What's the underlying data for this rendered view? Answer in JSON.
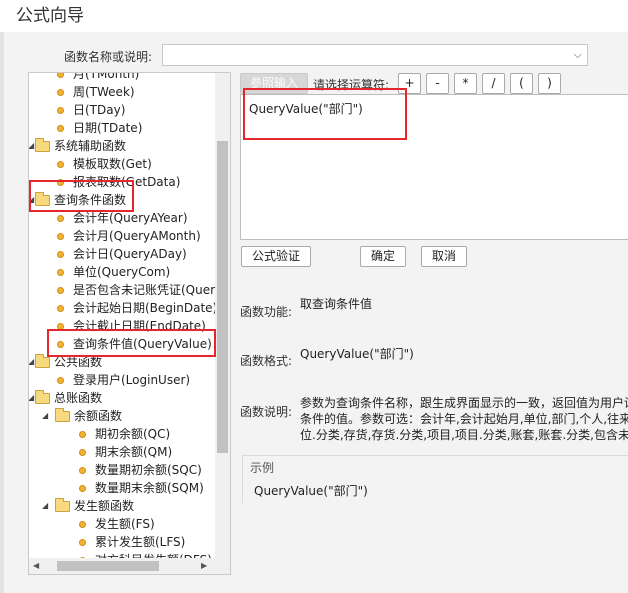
{
  "window": {
    "title": "公式向导"
  },
  "search": {
    "label": "函数名称或说明:",
    "value": ""
  },
  "tree": [
    {
      "label": "月(TMonth)",
      "type": "leaf",
      "level": 2
    },
    {
      "label": "周(TWeek)",
      "type": "leaf",
      "level": 2
    },
    {
      "label": "日(TDay)",
      "type": "leaf",
      "level": 2
    },
    {
      "label": "日期(TDate)",
      "type": "leaf",
      "level": 2
    },
    {
      "label": "系统辅助函数",
      "type": "folder",
      "level": 1,
      "expanded": true
    },
    {
      "label": "模板取数(Get)",
      "type": "leaf",
      "level": 2
    },
    {
      "label": "报表取数(GetData)",
      "type": "leaf",
      "level": 2
    },
    {
      "label": "查询条件函数",
      "type": "folder",
      "level": 1,
      "expanded": true
    },
    {
      "label": "会计年(QueryAYear)",
      "type": "leaf",
      "level": 2
    },
    {
      "label": "会计月(QueryAMonth)",
      "type": "leaf",
      "level": 2
    },
    {
      "label": "会计日(QueryADay)",
      "type": "leaf",
      "level": 2
    },
    {
      "label": "单位(QueryCom)",
      "type": "leaf",
      "level": 2
    },
    {
      "label": "是否包含未记账凭证(QueryIncludeUnpost)",
      "type": "leaf",
      "level": 2
    },
    {
      "label": "会计起始日期(BeginDate)",
      "type": "leaf",
      "level": 2
    },
    {
      "label": "会计截止日期(EndDate)",
      "type": "leaf",
      "level": 2
    },
    {
      "label": "查询条件值(QueryValue)",
      "type": "leaf",
      "level": 2,
      "selected": true
    },
    {
      "label": "公共函数",
      "type": "folder",
      "level": 1,
      "expanded": true
    },
    {
      "label": "登录用户(LoginUser)",
      "type": "leaf",
      "level": 2
    },
    {
      "label": "总账函数",
      "type": "folder",
      "level": 1,
      "expanded": true
    },
    {
      "label": "余额函数",
      "type": "folder",
      "level": 2,
      "expanded": true
    },
    {
      "label": "期初余额(QC)",
      "type": "leaf",
      "level": 3
    },
    {
      "label": "期末余额(QM)",
      "type": "leaf",
      "level": 3
    },
    {
      "label": "数量期初余额(SQC)",
      "type": "leaf",
      "level": 3
    },
    {
      "label": "数量期末余额(SQM)",
      "type": "leaf",
      "level": 3
    },
    {
      "label": "发生额函数",
      "type": "folder",
      "level": 2,
      "expanded": true
    },
    {
      "label": "发生额(FS)",
      "type": "leaf",
      "level": 3
    },
    {
      "label": "累计发生额(LFS)",
      "type": "leaf",
      "level": 3
    },
    {
      "label": "对方科目发生额(DFS)",
      "type": "leaf",
      "level": 3
    }
  ],
  "toolbar": {
    "ref_input": "参照输入",
    "operator_label": "请选择运算符:",
    "operators": [
      "+",
      "-",
      "*",
      "/",
      "(",
      ")"
    ]
  },
  "formula": "QueryValue(\"部门\")",
  "actions": {
    "verify": "公式验证",
    "ok": "确定",
    "cancel": "取消"
  },
  "info": {
    "function_label": "函数功能:",
    "function_value": "取查询条件值",
    "format_label": "函数格式:",
    "format_value": "QueryValue(\"部门\")",
    "desc_label": "函数说明:",
    "desc_lines": [
      "参数为查询条件名称，跟生成界面显示的一致，返回值为用户设",
      "条件的值。参数可选：会计年,会计起始月,单位,部门,个人,往来单",
      "位.分类,存货,存货.分类,项目,项目.分类,账套,账套.分类,包含未记"
    ]
  },
  "example": {
    "legend": "示例",
    "text": "QueryValue(\"部门\")"
  },
  "colors": {
    "highlight": "#e5262b",
    "folder": "#f7da7e",
    "leaf_dot": "#f2b233"
  }
}
